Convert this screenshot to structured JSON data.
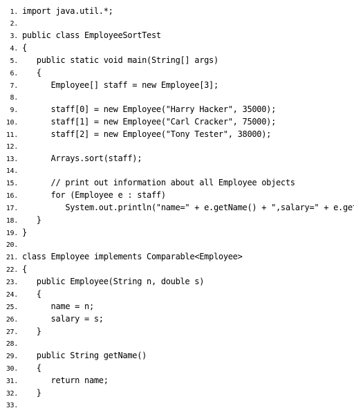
{
  "lines": [
    {
      "n": "1.",
      "t": "import java.util.*;"
    },
    {
      "n": "2.",
      "t": ""
    },
    {
      "n": "3.",
      "t": "public class EmployeeSortTest"
    },
    {
      "n": "4.",
      "t": "{"
    },
    {
      "n": "5.",
      "t": "   public static void main(String[] args)"
    },
    {
      "n": "6.",
      "t": "   {"
    },
    {
      "n": "7.",
      "t": "      Employee[] staff = new Employee[3];"
    },
    {
      "n": "8.",
      "t": ""
    },
    {
      "n": "9.",
      "t": "      staff[0] = new Employee(\"Harry Hacker\", 35000);"
    },
    {
      "n": "10.",
      "t": "      staff[1] = new Employee(\"Carl Cracker\", 75000);"
    },
    {
      "n": "11.",
      "t": "      staff[2] = new Employee(\"Tony Tester\", 38000);"
    },
    {
      "n": "12.",
      "t": ""
    },
    {
      "n": "13.",
      "t": "      Arrays.sort(staff);"
    },
    {
      "n": "14.",
      "t": ""
    },
    {
      "n": "15.",
      "t": "      // print out information about all Employee objects"
    },
    {
      "n": "16.",
      "t": "      for (Employee e : staff)"
    },
    {
      "n": "17.",
      "t": "         System.out.println(\"name=\" + e.getName() + \",salary=\" + e.getSalary());"
    },
    {
      "n": "18.",
      "t": "   }"
    },
    {
      "n": "19.",
      "t": "}"
    },
    {
      "n": "20.",
      "t": ""
    },
    {
      "n": "21.",
      "t": "class Employee implements Comparable<Employee>"
    },
    {
      "n": "22.",
      "t": "{"
    },
    {
      "n": "23.",
      "t": "   public Employee(String n, double s)"
    },
    {
      "n": "24.",
      "t": "   {"
    },
    {
      "n": "25.",
      "t": "      name = n;"
    },
    {
      "n": "26.",
      "t": "      salary = s;"
    },
    {
      "n": "27.",
      "t": "   }"
    },
    {
      "n": "28.",
      "t": ""
    },
    {
      "n": "29.",
      "t": "   public String getName()"
    },
    {
      "n": "30.",
      "t": "   {"
    },
    {
      "n": "31.",
      "t": "      return name;"
    },
    {
      "n": "32.",
      "t": "   }"
    },
    {
      "n": "33.",
      "t": ""
    }
  ]
}
